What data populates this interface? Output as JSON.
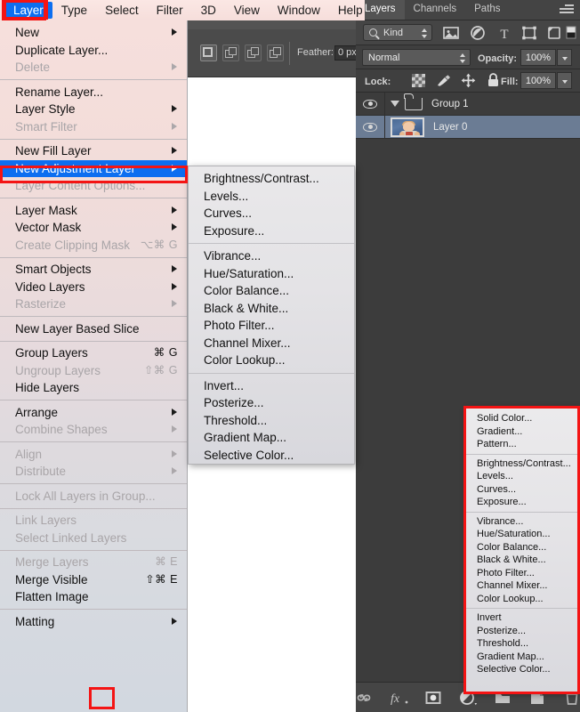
{
  "menubar": {
    "items": [
      {
        "label": "Layer",
        "selected": true
      },
      {
        "label": "Type",
        "selected": false
      },
      {
        "label": "Select",
        "selected": false
      },
      {
        "label": "Filter",
        "selected": false
      },
      {
        "label": "3D",
        "selected": false
      },
      {
        "label": "View",
        "selected": false
      },
      {
        "label": "Window",
        "selected": false
      },
      {
        "label": "Help",
        "selected": false
      }
    ]
  },
  "options_bar": {
    "feather_label": "Feather:",
    "feather_value": "0 px"
  },
  "layer_menu": {
    "groups": [
      {
        "items": [
          {
            "label": "New",
            "arrow": true,
            "dim": false,
            "shortcut": ""
          },
          {
            "label": "Duplicate Layer...",
            "arrow": false,
            "dim": false,
            "shortcut": ""
          },
          {
            "label": "Delete",
            "arrow": true,
            "dim": true,
            "shortcut": ""
          }
        ]
      },
      {
        "items": [
          {
            "label": "Rename Layer...",
            "arrow": false,
            "dim": false,
            "shortcut": ""
          },
          {
            "label": "Layer Style",
            "arrow": true,
            "dim": false,
            "shortcut": ""
          },
          {
            "label": "Smart Filter",
            "arrow": true,
            "dim": true,
            "shortcut": ""
          }
        ]
      },
      {
        "items": [
          {
            "label": "New Fill Layer",
            "arrow": true,
            "dim": false,
            "shortcut": ""
          },
          {
            "label": "New Adjustment Layer",
            "arrow": true,
            "dim": false,
            "shortcut": "",
            "highlighted": true
          },
          {
            "label": "Layer Content Options...",
            "arrow": false,
            "dim": true,
            "shortcut": ""
          }
        ]
      },
      {
        "items": [
          {
            "label": "Layer Mask",
            "arrow": true,
            "dim": false,
            "shortcut": ""
          },
          {
            "label": "Vector Mask",
            "arrow": true,
            "dim": false,
            "shortcut": ""
          },
          {
            "label": "Create Clipping Mask",
            "arrow": false,
            "dim": true,
            "shortcut": "⌥⌘ G"
          }
        ]
      },
      {
        "items": [
          {
            "label": "Smart Objects",
            "arrow": true,
            "dim": false,
            "shortcut": ""
          },
          {
            "label": "Video Layers",
            "arrow": true,
            "dim": false,
            "shortcut": ""
          },
          {
            "label": "Rasterize",
            "arrow": true,
            "dim": true,
            "shortcut": ""
          }
        ]
      },
      {
        "items": [
          {
            "label": "New Layer Based Slice",
            "arrow": false,
            "dim": false,
            "shortcut": ""
          }
        ]
      },
      {
        "items": [
          {
            "label": "Group Layers",
            "arrow": false,
            "dim": false,
            "shortcut": "⌘ G"
          },
          {
            "label": "Ungroup Layers",
            "arrow": false,
            "dim": true,
            "shortcut": "⇧⌘ G"
          },
          {
            "label": "Hide Layers",
            "arrow": false,
            "dim": false,
            "shortcut": ""
          }
        ]
      },
      {
        "items": [
          {
            "label": "Arrange",
            "arrow": true,
            "dim": false,
            "shortcut": ""
          },
          {
            "label": "Combine Shapes",
            "arrow": true,
            "dim": true,
            "shortcut": ""
          }
        ]
      },
      {
        "items": [
          {
            "label": "Align",
            "arrow": true,
            "dim": true,
            "shortcut": ""
          },
          {
            "label": "Distribute",
            "arrow": true,
            "dim": true,
            "shortcut": ""
          }
        ]
      },
      {
        "items": [
          {
            "label": "Lock All Layers in Group...",
            "arrow": false,
            "dim": true,
            "shortcut": ""
          }
        ]
      },
      {
        "items": [
          {
            "label": "Link Layers",
            "arrow": false,
            "dim": true,
            "shortcut": ""
          },
          {
            "label": "Select Linked Layers",
            "arrow": false,
            "dim": true,
            "shortcut": ""
          }
        ]
      },
      {
        "items": [
          {
            "label": "Merge Layers",
            "arrow": false,
            "dim": true,
            "shortcut": "⌘ E"
          },
          {
            "label": "Merge Visible",
            "arrow": false,
            "dim": false,
            "shortcut": "⇧⌘ E"
          },
          {
            "label": "Flatten Image",
            "arrow": false,
            "dim": false,
            "shortcut": ""
          }
        ]
      },
      {
        "items": [
          {
            "label": "Matting",
            "arrow": true,
            "dim": false,
            "shortcut": ""
          }
        ]
      }
    ]
  },
  "adjustment_submenu": {
    "groups": [
      {
        "items": [
          "Brightness/Contrast...",
          "Levels...",
          "Curves...",
          "Exposure..."
        ]
      },
      {
        "items": [
          "Vibrance...",
          "Hue/Saturation...",
          "Color Balance...",
          "Black & White...",
          "Photo Filter...",
          "Channel Mixer...",
          "Color Lookup..."
        ]
      },
      {
        "items": [
          "Invert...",
          "Posterize...",
          "Threshold...",
          "Gradient Map...",
          "Selective Color..."
        ]
      }
    ]
  },
  "layers_panel": {
    "tabs": [
      {
        "label": "Layers",
        "active": true
      },
      {
        "label": "Channels",
        "active": false
      },
      {
        "label": "Paths",
        "active": false
      }
    ],
    "panel_menu_icon": "panel-menu-icon",
    "filter": {
      "kind_label": "Kind",
      "icons": [
        "pixel-layer-filter-icon",
        "adjustment-layer-filter-icon",
        "type-layer-filter-icon",
        "shape-layer-filter-icon",
        "smart-object-filter-icon",
        "filter-toggle-icon"
      ]
    },
    "blend_mode": "Normal",
    "opacity_label": "Opacity:",
    "opacity_value": "100%",
    "lock_label": "Lock:",
    "lock_icons": [
      "lock-transparent-pixels-icon",
      "lock-image-pixels-icon",
      "lock-position-icon",
      "lock-all-icon"
    ],
    "fill_label": "Fill:",
    "fill_value": "100%",
    "rows": [
      {
        "name": "Group 1",
        "type": "group",
        "visible": true,
        "selected": false
      },
      {
        "name": "Layer 0",
        "type": "layer",
        "visible": true,
        "selected": true
      }
    ],
    "bottom_icons": [
      {
        "name": "link-layers-icon"
      },
      {
        "name": "layer-style-fx-icon"
      },
      {
        "name": "add-layer-mask-icon"
      },
      {
        "name": "new-adjustment-layer-icon",
        "highlighted": true
      },
      {
        "name": "new-group-icon"
      },
      {
        "name": "new-layer-icon"
      },
      {
        "name": "delete-layer-icon"
      }
    ]
  },
  "adjustment_popup": {
    "groups": [
      {
        "items": [
          "Solid Color...",
          "Gradient...",
          "Pattern..."
        ]
      },
      {
        "items": [
          "Brightness/Contrast...",
          "Levels...",
          "Curves...",
          "Exposure..."
        ]
      },
      {
        "items": [
          "Vibrance...",
          "Hue/Saturation...",
          "Color Balance...",
          "Black & White...",
          "Photo Filter...",
          "Channel Mixer...",
          "Color Lookup..."
        ]
      },
      {
        "items": [
          "Invert",
          "Posterize...",
          "Threshold...",
          "Gradient Map...",
          "Selective Color..."
        ]
      }
    ]
  },
  "annotations": {
    "highlight_color": "#f41414",
    "selection_color": "#0d6ef0"
  }
}
